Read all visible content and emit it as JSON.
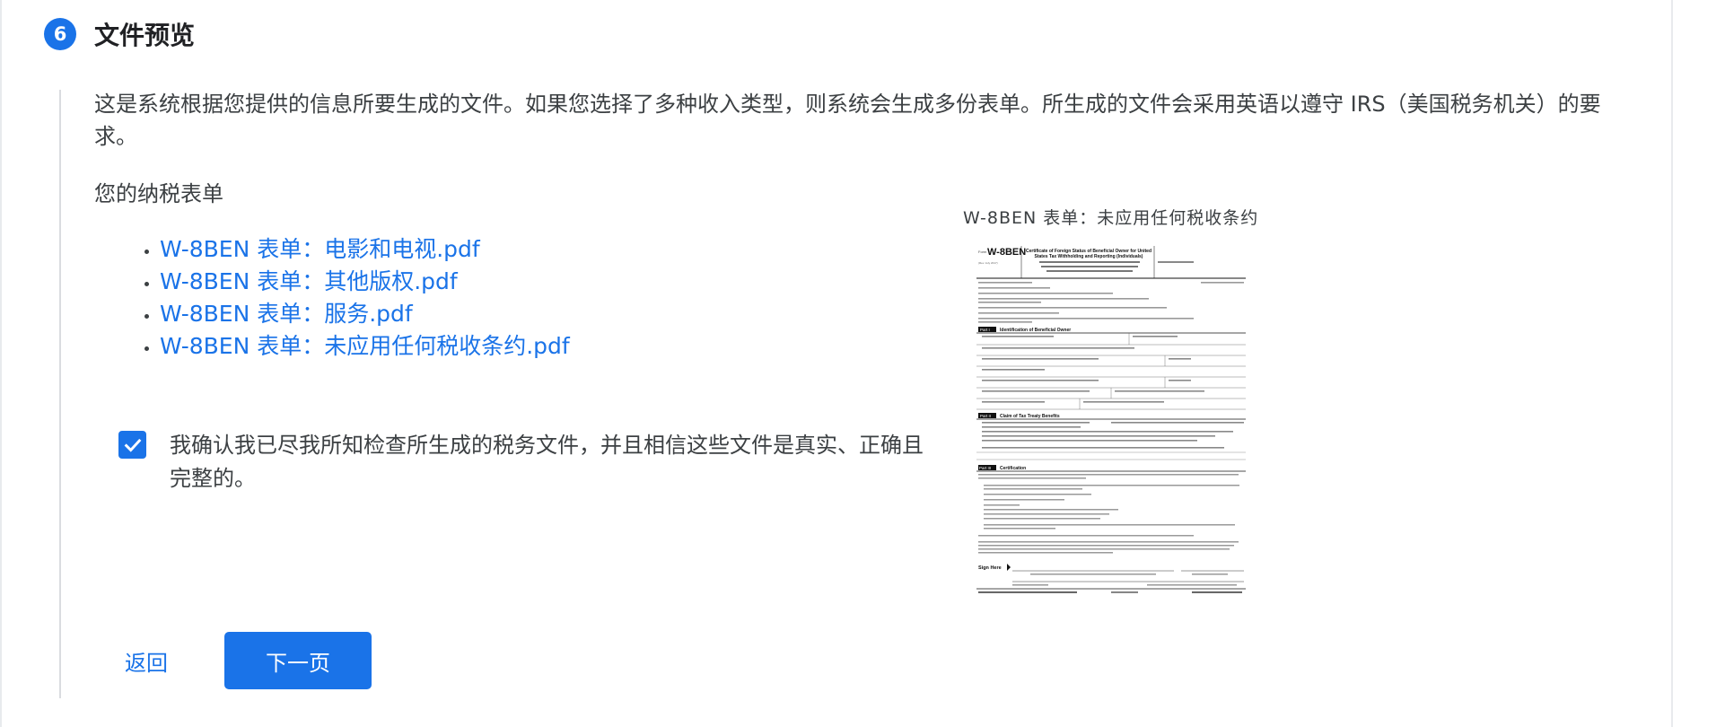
{
  "step": {
    "number": "6",
    "title": "文件预览"
  },
  "intro": "这是系统根据您提供的信息所要生成的文件。如果您选择了多种收入类型，则系统会生成多份表单。所生成的文件会采用英语以遵守 IRS（美国税务机关）的要求。",
  "forms": {
    "heading": "您的纳税表单",
    "files": [
      "W-8BEN 表单：电影和电视.pdf",
      "W-8BEN 表单：其他版权.pdf",
      "W-8BEN 表单：服务.pdf",
      "W-8BEN 表单：未应用任何税收条约.pdf"
    ]
  },
  "confirm": {
    "checked": true,
    "text": "我确认我已尽我所知检查所生成的税务文件，并且相信这些文件是真实、正确且完整的。"
  },
  "buttons": {
    "back": "返回",
    "next": "下一页"
  },
  "preview": {
    "label": "W-8BEN 表单：未应用任何税收条约",
    "form_name": "W-8BEN",
    "form_title_line1": "Certificate of Foreign Status of Beneficial Owner for United",
    "form_title_line2": "States Tax Withholding and Reporting (Individuals)",
    "part1": "Part I",
    "part1_title": "Identification of Beneficial Owner",
    "part2": "Part II",
    "part2_title": "Claim of Tax Treaty Benefits",
    "part3": "Part III",
    "part3_title": "Certification",
    "sign_here": "Sign Here"
  },
  "colors": {
    "accent": "#1a73e8",
    "text": "#3c4043"
  },
  "icons": {
    "checkbox": "checkmark-icon"
  }
}
